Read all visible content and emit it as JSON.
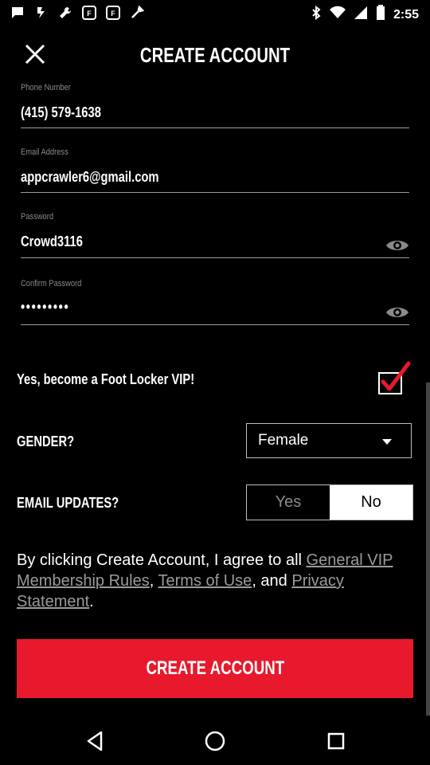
{
  "status_bar": {
    "time": "2:55",
    "icons": [
      "message-icon",
      "flash-icon",
      "wrench-icon",
      "footlocker-icon",
      "footlocker-icon",
      "tools-icon",
      "bluetooth-icon",
      "wifi-icon",
      "signal-icon",
      "battery-icon"
    ]
  },
  "header": {
    "title": "CREATE ACCOUNT",
    "close_icon": "close-icon"
  },
  "fields": [
    {
      "label": "Phone Number",
      "value": "(415) 579-1638"
    },
    {
      "label": "Email Address",
      "value": "appcrawler6@gmail.com"
    },
    {
      "label": "Password",
      "value": "Crowd3116",
      "icon": "eye-icon"
    },
    {
      "label": "Confirm Password",
      "value": "•••••••••",
      "icon": "eye-icon"
    }
  ],
  "vip": {
    "label": "Yes, become a Foot Locker VIP!",
    "checked": true
  },
  "gender": {
    "label": "GENDER?",
    "selected": "Female"
  },
  "email_updates": {
    "label": "EMAIL UPDATES?",
    "yes_label": "Yes",
    "no_label": "No",
    "selected": "No"
  },
  "agreement": {
    "prefix": "By clicking Create Account, I agree to all ",
    "link1": "General VIP Membership Rules",
    "sep1": ", ",
    "link2": "Terms of Use",
    "sep2": ", and ",
    "link3": "Privacy Statement",
    "suffix": "."
  },
  "create_button": {
    "label": "CREATE ACCOUNT",
    "color": "#e8192c"
  },
  "nav": {
    "back": "back-icon",
    "home": "home-icon",
    "recents": "recents-icon"
  }
}
